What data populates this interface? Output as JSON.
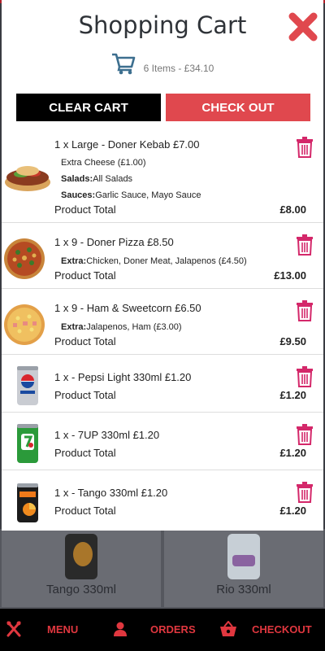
{
  "cart": {
    "title": "Shopping Cart",
    "summary": "6 Items - £34.10",
    "clear_label": "CLEAR CART",
    "checkout_label": "CHECK OUT",
    "product_total_label": "Product Total",
    "items": [
      {
        "title": "1 x Large - Doner Kebab £7.00",
        "lines": [
          {
            "key": "",
            "value": "Extra Cheese (£1.00)"
          },
          {
            "key": "Salads:",
            "value": "All Salads"
          },
          {
            "key": "Sauces:",
            "value": "Garlic Sauce, Mayo Sauce"
          }
        ],
        "total": "£8.00",
        "image": "doner-kebab"
      },
      {
        "title": "1 x 9 - Doner Pizza £8.50",
        "lines": [
          {
            "key": "Extra:",
            "value": "Chicken, Doner Meat, Jalapenos (£4.50)"
          }
        ],
        "total": "£13.00",
        "image": "pizza-doner"
      },
      {
        "title": "1 x 9 - Ham & Sweetcorn £6.50",
        "lines": [
          {
            "key": "Extra:",
            "value": "Jalapenos, Ham (£3.00)"
          }
        ],
        "total": "£9.50",
        "image": "pizza-ham"
      },
      {
        "title": "1 x - Pepsi Light 330ml £1.20",
        "lines": [],
        "total": "£1.20",
        "image": "pepsi-can"
      },
      {
        "title": "1 x - 7UP 330ml £1.20",
        "lines": [],
        "total": "£1.20",
        "image": "7up-can"
      },
      {
        "title": "1 x - Tango 330ml £1.20",
        "lines": [],
        "total": "£1.20",
        "image": "tango-can"
      }
    ]
  },
  "background": {
    "cards": [
      "Tango 330ml",
      "Rio 330ml"
    ]
  },
  "nav": {
    "menu": "MENU",
    "orders": "ORDERS",
    "checkout": "CHECKOUT"
  },
  "colors": {
    "accent": "#e0484e",
    "trash": "#d4286a",
    "nav_text": "#e0373f"
  }
}
